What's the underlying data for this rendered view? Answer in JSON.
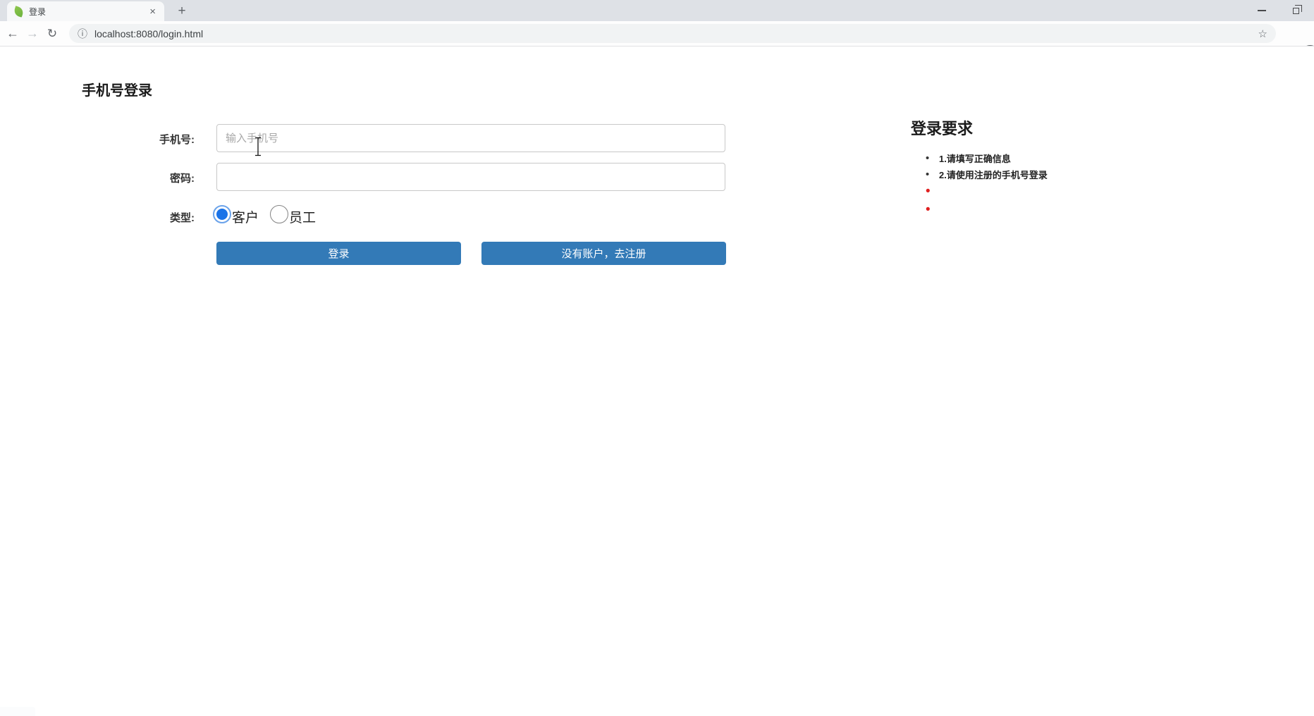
{
  "browser": {
    "tab": {
      "title": "登录",
      "favicon": "spring-leaf-icon"
    },
    "url": "localhost:8080/login.html",
    "icons": {
      "back": "←",
      "forward": "→",
      "reload": "↻",
      "info": "ⓘ",
      "star": "☆",
      "tab_close": "×",
      "new_tab": "+"
    }
  },
  "page": {
    "title": "手机号登录",
    "form": {
      "phone_label": "手机号:",
      "phone_placeholder": "输入手机号",
      "phone_value": "",
      "password_label": "密码:",
      "password_value": "",
      "type_label": "类型:",
      "radio_options": [
        {
          "label": "客户",
          "selected": true
        },
        {
          "label": "员工",
          "selected": false
        }
      ],
      "login_button": "登录",
      "register_button": "没有账户，去注册"
    },
    "requirements": {
      "heading": "登录要求",
      "items": [
        {
          "text": "1.请填写正确信息",
          "bullet_color": "#333333"
        },
        {
          "text": "2.请使用注册的手机号登录",
          "bullet_color": "#333333"
        },
        {
          "text": "",
          "bullet_color": "#e02020"
        },
        {
          "text": "",
          "bullet_color": "#e02020"
        }
      ]
    }
  },
  "colors": {
    "button_blue": "#337ab7",
    "radio_blue": "#1a73e8",
    "bullet_red": "#e02020",
    "tabstrip_gray": "#dee1e6"
  }
}
